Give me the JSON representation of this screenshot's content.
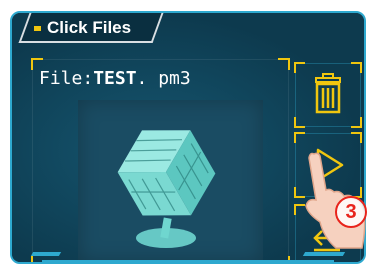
{
  "header": {
    "title": "Click Files"
  },
  "file": {
    "prefix": "File:",
    "name": "TEST",
    "extension": ". pm3"
  },
  "buttons": {
    "delete_icon": "trash-icon",
    "print_icon": "play-triangle-icon",
    "back_icon": "back-arrow-icon"
  },
  "annotation": {
    "step_number": "3"
  },
  "colors": {
    "frame_bg": "#0d3a4e",
    "frame_border": "#2ea9cf",
    "accent": "#f0c60f",
    "step_red": "#e8241c"
  }
}
